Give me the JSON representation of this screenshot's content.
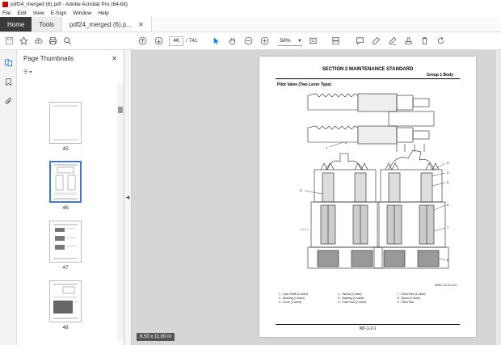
{
  "window": {
    "title": "pdf24_merged (6).pdf - Adobe Acrobat Pro (64-bit)"
  },
  "menu": [
    "File",
    "Edit",
    "View",
    "E-Sign",
    "Window",
    "Help"
  ],
  "tabs": {
    "home": "Home",
    "tools": "Tools",
    "document": "pdf24_merged (6).p..."
  },
  "toolbar": {
    "current_page": "46",
    "total_pages": "/ 741",
    "zoom": "58%"
  },
  "panel": {
    "title": "Page Thumbnails",
    "thumbnails": [
      {
        "label": "45"
      },
      {
        "label": "46",
        "selected": true
      },
      {
        "label": "47"
      },
      {
        "label": "48"
      }
    ]
  },
  "page": {
    "title": "SECTION 2 MAINTENANCE STANDARD",
    "group": "Group 1 Body",
    "section": "Pilot Valve (Two Lever Type)",
    "figure_ref": "W80C-02-01-003",
    "legend": [
      "1 - Cam Shaft (2 Used)",
      "4 - Screw (4 Used)",
      "7 - Push Rod (4 Used)",
      "2 - Bushing (4 Used)",
      "5 - Bushing (4 Used)",
      "8 - Spool (4 Used)",
      "3 - Lever (2 Used)",
      "6 - Push Rod (2 Used)",
      "9 - Push Rod"
    ],
    "page_number": "W2-1-2-1",
    "callouts": [
      "1",
      "2",
      "3",
      "4",
      "5",
      "6",
      "7",
      "8",
      "9"
    ]
  },
  "status": {
    "page_size": "8.50 x 11.00 in"
  }
}
